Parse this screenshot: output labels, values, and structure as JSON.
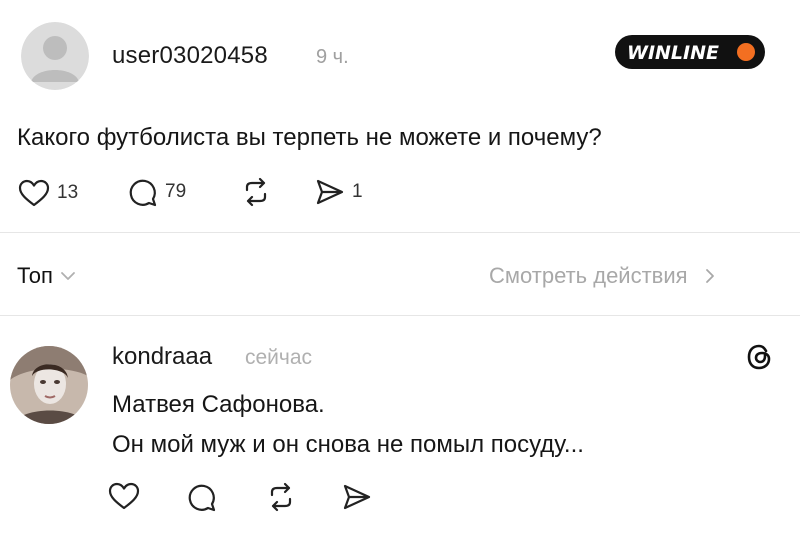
{
  "post": {
    "username": "user03020458",
    "time": "9 ч.",
    "brand": "WINLINE",
    "text": "Какого футболиста вы терпеть не можете и почему?",
    "likes": "13",
    "replies": "79",
    "shares": "1"
  },
  "filters": {
    "sort_label": "Топ",
    "view_activity_label": "Смотреть действия"
  },
  "comment": {
    "username": "kondraaa",
    "time": "сейчас",
    "line1": "Матвея Сафонова.",
    "line2": "Он мой муж и он снова не помыл посуду..."
  },
  "icons": {
    "avatar_default": "default-avatar-icon",
    "like": "heart-icon",
    "reply": "speech-bubble-icon",
    "repost": "repost-icon",
    "share": "send-icon",
    "sort": "chevron-down-icon",
    "view": "chevron-right-icon",
    "threads": "threads-logo-icon"
  },
  "colors": {
    "brand_black": "#111111",
    "brand_orange": "#f36f21",
    "muted_text": "#a8a8a8",
    "divider": "#e6e6e6"
  }
}
